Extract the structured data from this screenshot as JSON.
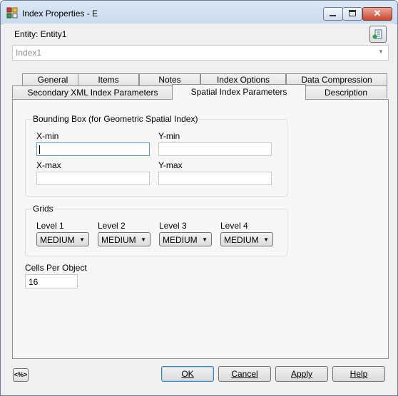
{
  "window": {
    "title": "Index Properties - E",
    "entity_label": "Entity: Entity1",
    "index_combo_value": "Index1"
  },
  "tabs": {
    "row1": [
      "General",
      "Items",
      "Notes",
      "Index Options",
      "Data Compression"
    ],
    "row2": [
      "Secondary XML Index Parameters",
      "Spatial Index Parameters",
      "Description"
    ],
    "active": "Spatial Index Parameters"
  },
  "bounding_box": {
    "title": "Bounding Box (for Geometric Spatial Index)",
    "xmin_label": "X-min",
    "ymin_label": "Y-min",
    "xmax_label": "X-max",
    "ymax_label": "Y-max",
    "xmin_value": "",
    "ymin_value": "",
    "xmax_value": "",
    "ymax_value": ""
  },
  "grids": {
    "title": "Grids",
    "levels": [
      {
        "label": "Level 1",
        "value": "MEDIUM"
      },
      {
        "label": "Level 2",
        "value": "MEDIUM"
      },
      {
        "label": "Level 3",
        "value": "MEDIUM"
      },
      {
        "label": "Level 4",
        "value": "MEDIUM"
      }
    ]
  },
  "cells_per_object": {
    "label": "Cells Per Object",
    "value": "16"
  },
  "buttons": {
    "code": "<%>",
    "ok": "OK",
    "cancel": "Cancel",
    "apply": "Apply",
    "help": "Help"
  },
  "colors": {
    "focus_border": "#5c9bd1",
    "close_button": "#c9462c"
  }
}
